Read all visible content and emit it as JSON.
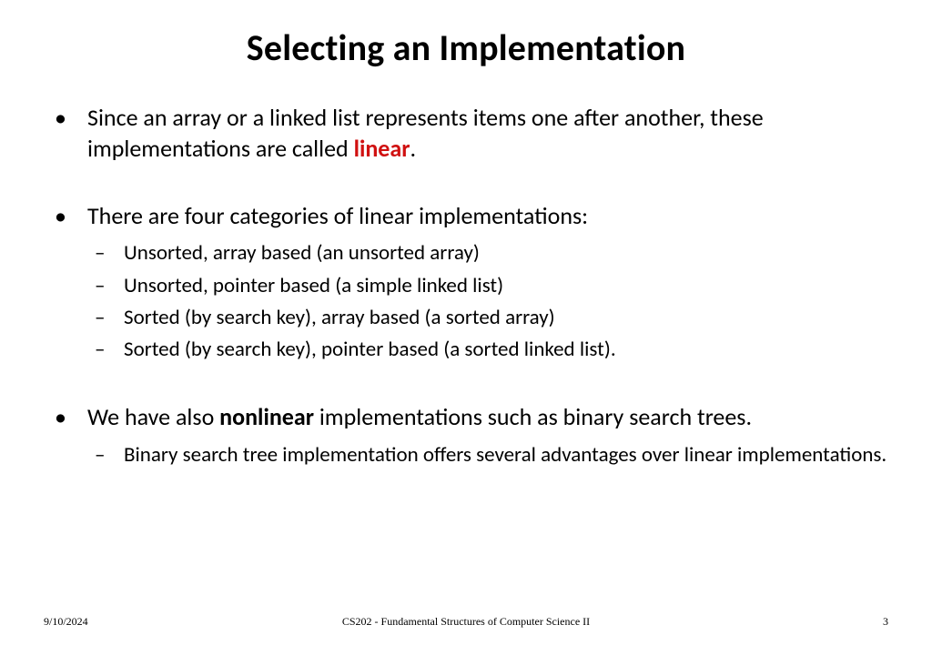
{
  "title": "Selecting an Implementation",
  "bullets": {
    "b1_pre": "Since an array or a linked list represents items one after another, these implementations are called ",
    "b1_highlight": "linear",
    "b1_post": ".",
    "b2": "There are four categories of linear implementations:",
    "b2_subs": {
      "s1": "Unsorted, array based  (an unsorted array)",
      "s2": "Unsorted, pointer based (a simple linked list)",
      "s3": "Sorted (by search key), array based (a sorted array)",
      "s4": "Sorted (by search key), pointer based (a sorted linked list)."
    },
    "b3_pre": "We have also ",
    "b3_bold": "nonlinear",
    "b3_post": " implementations such as binary search trees.",
    "b3_subs": {
      "s1": "Binary search tree implementation offers several advantages over linear implementations."
    }
  },
  "footer": {
    "date": "9/10/2024",
    "course": "CS202 - Fundamental Structures of Computer Science II",
    "page": "3"
  }
}
